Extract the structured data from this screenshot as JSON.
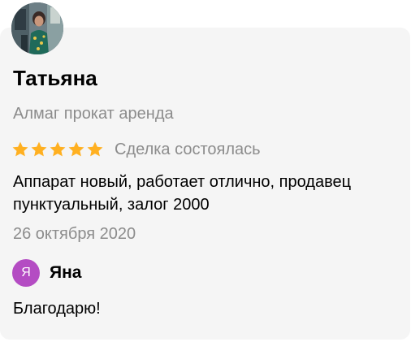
{
  "review": {
    "reviewer_name": "Татьяна",
    "item_title": "Алмаг прокат аренда",
    "rating": 5,
    "rating_max": 5,
    "deal_status": "Сделка состоялась",
    "text": "Аппарат новый, работает отлично, продавец пунктуальный, залог 2000",
    "date": "26 октября 2020"
  },
  "reply": {
    "avatar_letter": "Я",
    "author_name": "Яна",
    "text": "Благодарю!"
  },
  "colors": {
    "card_background": "#f5f5f5",
    "star": "#ffb021",
    "secondary_text": "#8c8c8c",
    "reply_avatar": "#b44cc3"
  },
  "icons": {
    "star": "star-icon",
    "reviewer_avatar": "user-photo-avatar"
  }
}
